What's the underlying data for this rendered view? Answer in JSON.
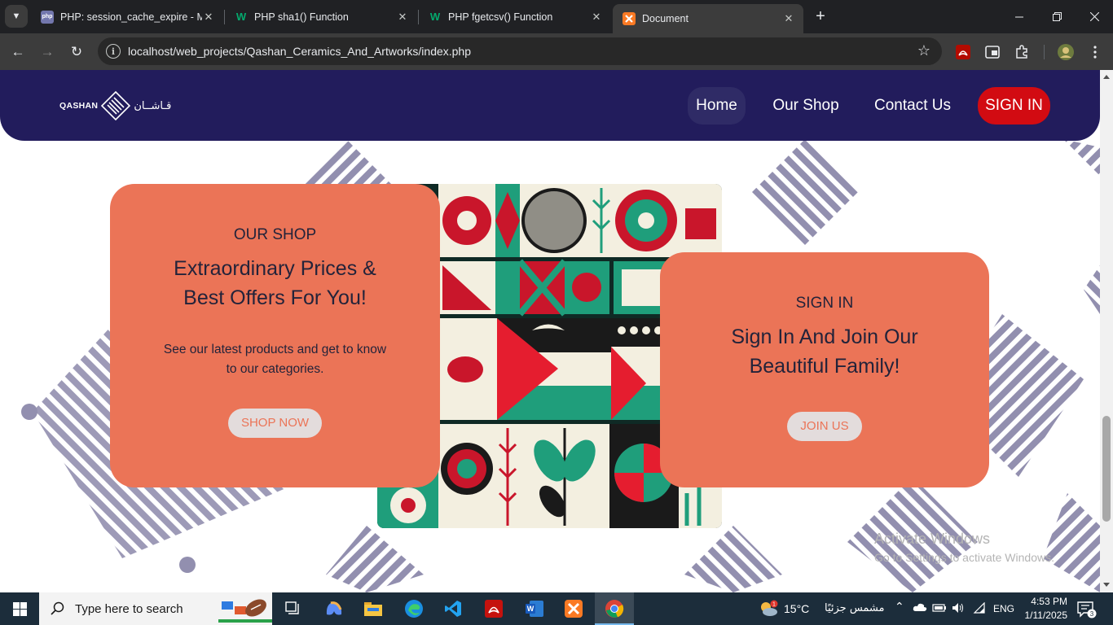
{
  "browser": {
    "tabs": [
      {
        "title": "PHP: session_cache_expire - Ma",
        "favicon": "php"
      },
      {
        "title": "PHP sha1() Function",
        "favicon": "w3"
      },
      {
        "title": "PHP fgetcsv() Function",
        "favicon": "w3"
      },
      {
        "title": "Document",
        "favicon": "xampp"
      }
    ],
    "url_host": "localhost",
    "url_path": "/web_projects/Qashan_Ceramics_And_Artworks/index.php"
  },
  "site": {
    "logo_text": "QASHAN",
    "logo_arabic": "قـاشــان",
    "nav": {
      "home": "Home",
      "shop": "Our Shop",
      "contact": "Contact Us",
      "signin": "SIGN IN"
    },
    "shop_card": {
      "kicker": "OUR SHOP",
      "headline_1": "Extraordinary Prices &",
      "headline_2": "Best Offers For You!",
      "desc_1": "See our latest products and get to know",
      "desc_2": "to our categories.",
      "button": "SHOP NOW"
    },
    "signin_card": {
      "kicker": "SIGN IN",
      "headline_1": "Sign In And Join Our",
      "headline_2": "Beautiful Family!",
      "button": "JOIN US"
    },
    "colors": {
      "header": "#221c5c",
      "card": "#eb7457",
      "signin_button": "#d20b12",
      "pattern": "#8d8aab"
    }
  },
  "watermark": {
    "line1": "Activate Windows",
    "line2": "Go to Settings to activate Windows."
  },
  "taskbar": {
    "search_placeholder": "Type here to search",
    "weather_temp": "15°C",
    "weather_text": "مشمس جزئيًا",
    "weather_badge": "1",
    "language": "ENG",
    "time": "4:53 PM",
    "date": "1/11/2025",
    "notification_count": "3"
  }
}
